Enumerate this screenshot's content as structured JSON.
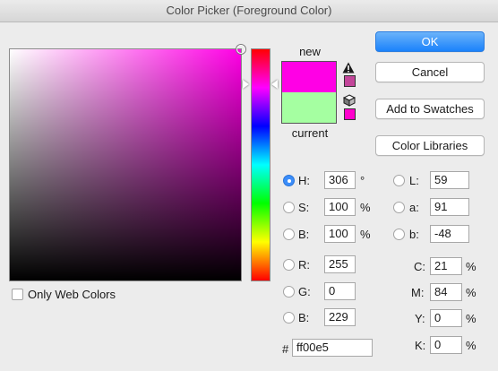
{
  "window": {
    "title": "Color Picker (Foreground Color)"
  },
  "colors": {
    "new": "#ff00e5",
    "current": "#a5ffa1",
    "accent": "#1a82fb"
  },
  "preview": {
    "new_label": "new",
    "current_label": "current"
  },
  "buttons": {
    "ok": "OK",
    "cancel": "Cancel",
    "add_to_swatches": "Add to Swatches",
    "color_libraries": "Color Libraries"
  },
  "hsb": {
    "h": {
      "label": "H:",
      "value": "306",
      "unit": "°"
    },
    "s": {
      "label": "S:",
      "value": "100",
      "unit": "%"
    },
    "b": {
      "label": "B:",
      "value": "100",
      "unit": "%"
    }
  },
  "rgb": {
    "r": {
      "label": "R:",
      "value": "255"
    },
    "g": {
      "label": "G:",
      "value": "0"
    },
    "b": {
      "label": "B:",
      "value": "229"
    }
  },
  "lab": {
    "l": {
      "label": "L:",
      "value": "59"
    },
    "a": {
      "label": "a:",
      "value": "91"
    },
    "b": {
      "label": "b:",
      "value": "-48"
    }
  },
  "cmyk": {
    "c": {
      "label": "C:",
      "value": "21",
      "unit": "%"
    },
    "m": {
      "label": "M:",
      "value": "84",
      "unit": "%"
    },
    "y": {
      "label": "Y:",
      "value": "0",
      "unit": "%"
    },
    "k": {
      "label": "K:",
      "value": "0",
      "unit": "%"
    }
  },
  "hex": {
    "label": "#",
    "value": "ff00e5"
  },
  "web_colors": {
    "label": "Only Web Colors",
    "checked": false
  },
  "selected_mode": "H"
}
